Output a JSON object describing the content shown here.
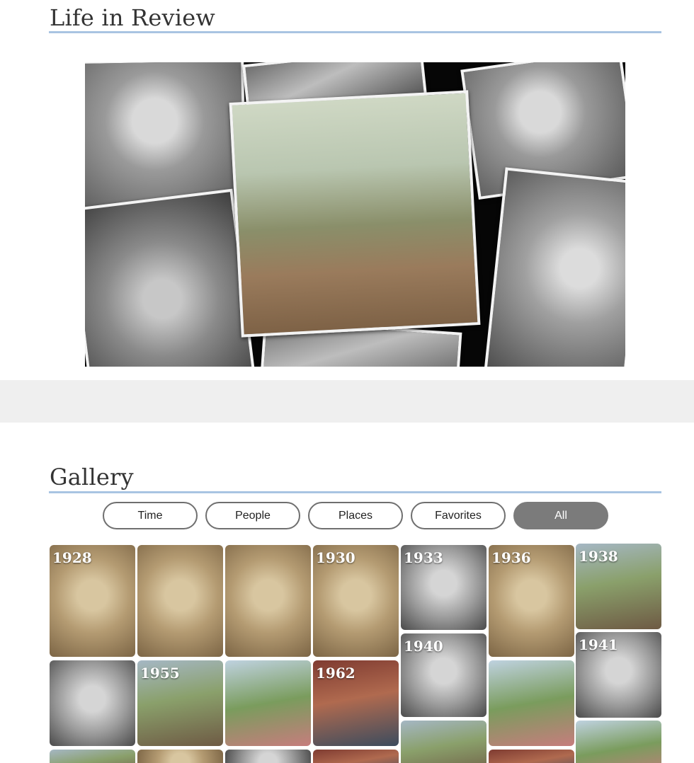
{
  "review": {
    "title": "Life in Review"
  },
  "gallery": {
    "title": "Gallery",
    "filters": [
      "Time",
      "People",
      "Places",
      "Favorites",
      "All"
    ],
    "active_filter": "All",
    "years": [
      "1928",
      "1930",
      "1933",
      "1936",
      "1938",
      "1940",
      "1941",
      "1955",
      "1962"
    ]
  },
  "colors": {
    "accent_rule": "#a9c4e2",
    "active_filter_bg": "#7b7b7b",
    "band": "#efefef"
  }
}
